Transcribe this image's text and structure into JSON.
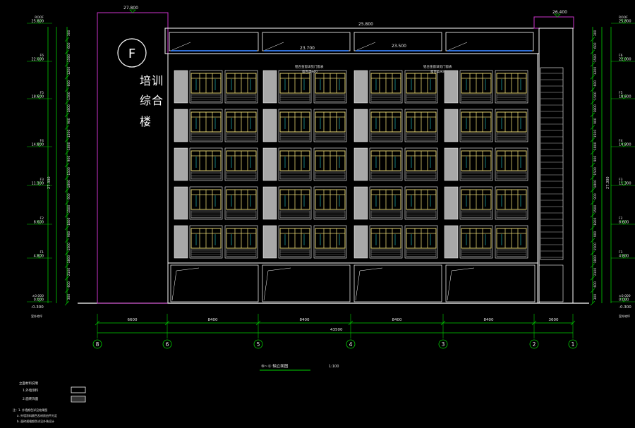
{
  "building_label": {
    "letter": "F",
    "name_chars": [
      "培",
      "训",
      "综",
      "合",
      "楼"
    ]
  },
  "top_labels": {
    "left_parapet": "27.800",
    "right_parapet": "26.400",
    "roof": "25.800",
    "upper_left": "23.700",
    "upper_right": "23.500"
  },
  "elevation_levels": [
    {
      "mark": "±0.000",
      "num": "0.000"
    },
    {
      "mark": "F1",
      "num": "4.800"
    },
    {
      "mark": "F2",
      "num": "8.600"
    },
    {
      "mark": "F3",
      "num": "11.300"
    },
    {
      "mark": "F4",
      "num": "14.800"
    },
    {
      "mark": "F5",
      "num": "18.600"
    },
    {
      "mark": "F6",
      "num": "22.000"
    },
    {
      "mark": "ROOF",
      "num": "25.800"
    }
  ],
  "side_dims": {
    "segments": [
      "300",
      "600",
      "2100",
      "1800",
      "1500",
      "900",
      "1800",
      "1500",
      "900",
      "1800",
      "1500",
      "900",
      "1800",
      "1500",
      "900",
      "1800",
      "1500",
      "600",
      "1200",
      "1500",
      "600",
      "300"
    ],
    "totals": [
      "3800",
      "3800",
      "3800",
      "3800",
      "3800",
      "3800"
    ],
    "overall": "27.300",
    "bottom_left": "-0.300",
    "bottom_right": "-0.300",
    "ground_note_left": "室外地坪",
    "ground_note_right": "室外地坪"
  },
  "window_note": [
    "铝合金窗详见门窗表",
    "窗台高900"
  ],
  "bay_dims": [
    "6600",
    "8400",
    "8400",
    "8400",
    "8400",
    "3600"
  ],
  "overall_width": "43500",
  "grid_axes": [
    "8",
    "6",
    "5",
    "4",
    "3",
    "2",
    "1"
  ],
  "title": {
    "text": "⑧~① 轴立面图",
    "scale": "1:100"
  },
  "legend": {
    "heading": "立面材料说明",
    "items": [
      "1.外墙涂料",
      "2.面砖饰面"
    ],
    "notes": [
      "注：1. 外墙颜色详见效果图",
      "a. 外墙涂料颜色及材质由甲方定",
      "b. 面砖规格颜色详见外装设计"
    ]
  },
  "colors": {
    "background": "#000000",
    "outline": "#ffffff",
    "window_frame": "#e0d070",
    "dimension": "#00d000",
    "parapet": "#cc33cc",
    "roof_blue": "#2f6fd8",
    "panel_grey": "#a8a8a8"
  }
}
